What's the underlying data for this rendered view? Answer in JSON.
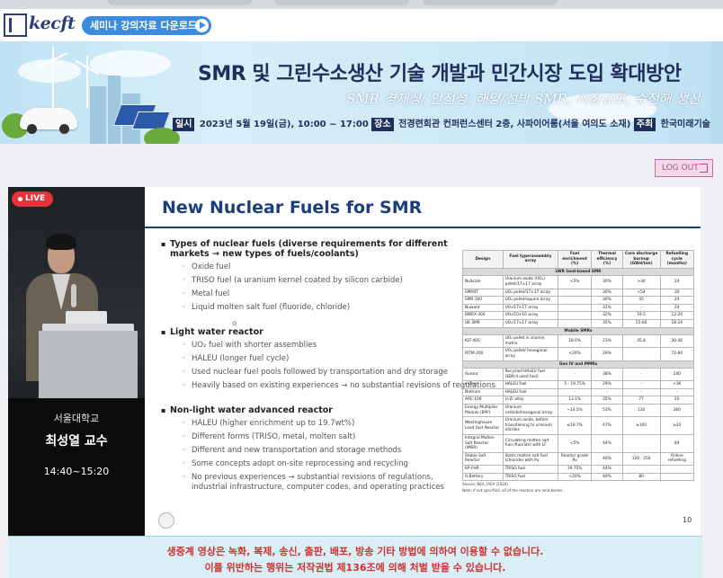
{
  "header": {
    "logo_text": "kecft",
    "download_label": "세미나 강의자료 다운로드"
  },
  "banner": {
    "title": "SMR 및 그린수소생산 기술 개발과 민간시장 도입 확대방안",
    "subtitle": "SMR 경제성/ 안전성, 해양/선박 SMR, 시장규모, 수전해 생산",
    "date_tag": "일시",
    "date": "2023년 5월 19일(금), 10:00 ~ 17:00",
    "place_tag": "장소",
    "place": "전경련회관 컨퍼런스센터 2층, 사파이어룸(서울 여의도 소재)",
    "host_tag": "주최",
    "host": "한국미래기술교육연구원"
  },
  "logout_label": "LOG OUT",
  "video": {
    "live_label": "LIVE",
    "school": "서울대학교",
    "professor": "최성열 교수",
    "time": "14:40~15:20"
  },
  "slide": {
    "title": "New Nuclear Fuels for SMR",
    "page_number": "10",
    "sections": [
      {
        "heading": "Types of nuclear fuels (diverse requirements for different markets → new types of fuels/coolants)",
        "items": [
          "Oxide fuel",
          "TRISO fuel (a uranium kernel coated by silicon carbide)",
          "Metal fuel",
          "Liquid molten salt fuel (fluoride, chloride)"
        ]
      },
      {
        "heading": "Light water reactor",
        "items": [
          "UO₂ fuel with shorter assemblies",
          "HALEU (longer fuel cycle)",
          "Used nuclear fuel pools followed by transportation and dry storage",
          "Heavily based on existing experiences → no substantial revisions of regulations"
        ]
      },
      {
        "heading": "Non-light water advanced reactor",
        "items": [
          "HALEU (higher enrichment up to 19.7wt%)",
          "Different forms (TRISO, metal, molten salt)",
          "Different and new transportation and storage methods",
          "Some concepts adopt on-site reprocessing and recycling",
          "No previous experiences → substantial revisions of regulations, industrial infrastructure, computer codes, and operating practices"
        ]
      }
    ],
    "table": {
      "headers": [
        "Design",
        "Fuel type/assembly array",
        "Fuel enrichment (%)",
        "Thermal efficiency (%)",
        "Core discharge burnup (GWd/ton)",
        "Refuelling cycle (months)"
      ],
      "groups": [
        {
          "label": "LWR land-based SMR",
          "rows": [
            [
              "NuScale",
              "Uranium oxide (UO₂) pellet/17×17 array",
              "<5%",
              "30%",
              ">30",
              "24"
            ],
            [
              "SMART",
              "UO₂ pellet/17×17 array",
              "",
              "30%",
              "<54",
              "30"
            ],
            [
              "SMR-160",
              "UO₂ pellet/square array",
              "",
              "30%",
              "45",
              "24"
            ],
            [
              "Nuward",
              "UO₂/17×17 array",
              "",
              "31%",
              "-",
              "24"
            ],
            [
              "BWRX-300",
              "UO₂/10×10 array",
              "",
              "32%",
              "19.5",
              "12-24"
            ],
            [
              "UK SMR",
              "UO₂/17×17 array",
              "",
              "35%",
              "55-60",
              "18-24"
            ]
          ]
        },
        {
          "label": "Mobile SMRs",
          "rows": [
            [
              "KLT-40S",
              "UO₂ pellet in silumin matrix",
              "18.6%",
              "23%",
              "45.4",
              "30-36"
            ],
            [
              "RITM-200",
              "UO₂ pellet/ hexagonal array",
              "<20%",
              "29%",
              "",
              "72-84"
            ]
          ]
        },
        {
          "label": "Gen IV and MMRs",
          "rows": [
            [
              "Aurora",
              "Recycled HALEU fuel (EBR-II used fuel)",
              "-",
              "38%",
              "-",
              "240"
            ],
            [
              "eVinci",
              "HALEU fuel",
              "5 - 19.75%",
              "29%",
              "-",
              ">36"
            ],
            [
              "Natrium",
              "HALEU fuel",
              "-",
              "-",
              "-",
              "-"
            ],
            [
              "ARC-100",
              "U-Zr alloy",
              "13.1%",
              "35%",
              "77",
              "20"
            ],
            [
              "Energy Multiplier Module (EM²)",
              "Uranium carbide/hexagonal array",
              "~14.5%",
              "53%",
              "130",
              "360"
            ],
            [
              "Westinghouse Lead Fast Reactor",
              "Uranium oxide, before transitioning to uranium nitrides",
              "≤19.7%",
              "47%",
              "≥100",
              "≥24"
            ],
            [
              "Integral Molten Salt Reactor (IMSR)",
              "Circulating molten salt fuel (fluoride) with LF",
              "<5%",
              "44%",
              "",
              "84"
            ],
            [
              "Stable Salt Reactor",
              "Static molten salt fuel (chloride) with Pu",
              "Reactor grade Pu",
              "40%",
              "120 - 250",
              "Online refuelling"
            ],
            [
              "KP-FHR",
              "TRISO fuel",
              "19.75%",
              "44%",
              "",
              ""
            ],
            [
              "U-Battery",
              "TRISO fuel",
              "<20%",
              "40%",
              "80",
              ""
            ]
          ]
        }
      ],
      "source": "Source: NEA, IAEA (2020)",
      "note": "Note: if not specified, all of the reactors are land-based."
    }
  },
  "footer": {
    "line1": "생중계 영상은 녹화, 복제, 송신, 출판, 배포, 방송 기타 방법에 의하여 이용할 수 없습니다.",
    "line2": "이를 위반하는 행위는 저작권법 제136조에 의해 처벌 받을 수 있습니다."
  },
  "colors": {
    "accent_blue": "#3d8be0",
    "slide_title": "#1c3f7c",
    "live_red": "#e5333a",
    "footer_red": "#d1312f",
    "logout_pink": "#b04a8c"
  }
}
